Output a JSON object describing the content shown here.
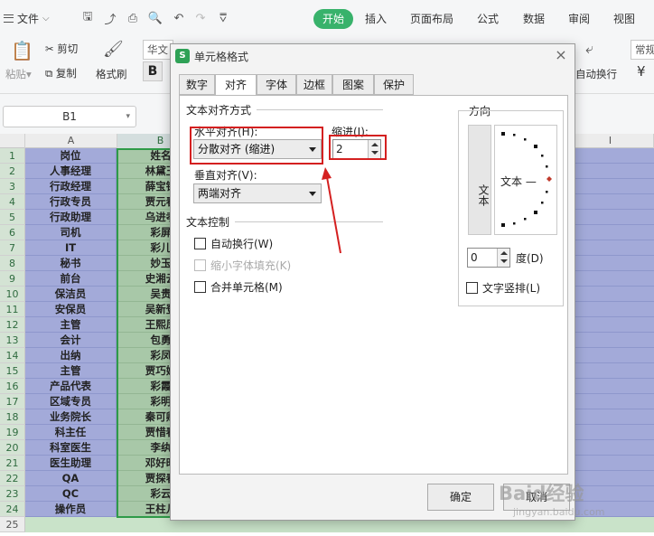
{
  "menubar": {
    "file_label": "文件",
    "tabs": [
      "开始",
      "插入",
      "页面布局",
      "公式",
      "数据",
      "审阅",
      "视图"
    ]
  },
  "ribbon": {
    "paste_label": "粘贴",
    "cut_label": "剪切",
    "copy_label": "复制",
    "format_painter_label": "格式刷",
    "font_name": "华文",
    "bold_label": "B",
    "wrap_label": "自动换行",
    "number_format": "常规",
    "currency_symbol": "¥"
  },
  "formula_bar": {
    "name_box": "B1"
  },
  "grid": {
    "columns": [
      "A",
      "B",
      "I"
    ],
    "rows": [
      {
        "n": "1",
        "a": "岗位",
        "b": "姓名"
      },
      {
        "n": "2",
        "a": "人事经理",
        "b": "林黛玉"
      },
      {
        "n": "3",
        "a": "行政经理",
        "b": "薛宝钗"
      },
      {
        "n": "4",
        "a": "行政专员",
        "b": "贾元春"
      },
      {
        "n": "5",
        "a": "行政助理",
        "b": "乌进孝"
      },
      {
        "n": "6",
        "a": "司机",
        "b": "彩屏"
      },
      {
        "n": "7",
        "a": "IT",
        "b": "彩儿"
      },
      {
        "n": "8",
        "a": "秘书",
        "b": "妙玉"
      },
      {
        "n": "9",
        "a": "前台",
        "b": "史湘云"
      },
      {
        "n": "10",
        "a": "保洁员",
        "b": "吴贵"
      },
      {
        "n": "11",
        "a": "安保员",
        "b": "吴新登"
      },
      {
        "n": "12",
        "a": "主管",
        "b": "王熙凤"
      },
      {
        "n": "13",
        "a": "会计",
        "b": "包勇"
      },
      {
        "n": "14",
        "a": "出纳",
        "b": "彩凤"
      },
      {
        "n": "15",
        "a": "主管",
        "b": "贾巧姐"
      },
      {
        "n": "16",
        "a": "产品代表",
        "b": "彩霞"
      },
      {
        "n": "17",
        "a": "区域专员",
        "b": "彩明"
      },
      {
        "n": "18",
        "a": "业务院长",
        "b": "秦可卿"
      },
      {
        "n": "19",
        "a": "科主任",
        "b": "贾惜春"
      },
      {
        "n": "20",
        "a": "科室医生",
        "b": "李纨"
      },
      {
        "n": "21",
        "a": "医生助理",
        "b": "邓好时"
      },
      {
        "n": "22",
        "a": "QA",
        "b": "贾探春"
      },
      {
        "n": "23",
        "a": "QC",
        "b": "彩云"
      },
      {
        "n": "24",
        "a": "操作员",
        "b": "王柱儿"
      },
      {
        "n": "25",
        "a": "",
        "b": ""
      }
    ]
  },
  "dialog": {
    "title": "单元格格式",
    "close_glyph": "×",
    "tabs": [
      "数字",
      "对齐",
      "字体",
      "边框",
      "图案",
      "保护"
    ],
    "active_tab": "对齐",
    "text_alignment_section": "文本对齐方式",
    "horizontal_label": "水平对齐(H):",
    "horizontal_value": "分散对齐 (缩进)",
    "indent_label": "缩进(I):",
    "indent_value": "2",
    "vertical_label": "垂直对齐(V):",
    "vertical_value": "两端对齐",
    "text_control_section": "文本控制",
    "wrap_text_label": "自动换行(W)",
    "shrink_to_fit_label": "缩小字体填充(K)",
    "merge_cells_label": "合并单元格(M)",
    "orientation_section": "方向",
    "vertical_text": "文本",
    "dial_text": "文本 —",
    "degrees_value": "0",
    "degrees_label": "度(D)",
    "vertical_layout_label": "文字竖排(L)",
    "ok_label": "确定",
    "cancel_label": "取消"
  },
  "watermark": {
    "text": "Baid经验",
    "sub": "jingyan.baidu.com"
  },
  "colors": {
    "accent_green": "#38b26b",
    "column_a_fill": "#a3aad9",
    "column_b_fill": "#a8c8a8",
    "annotation_red": "#d42020"
  }
}
